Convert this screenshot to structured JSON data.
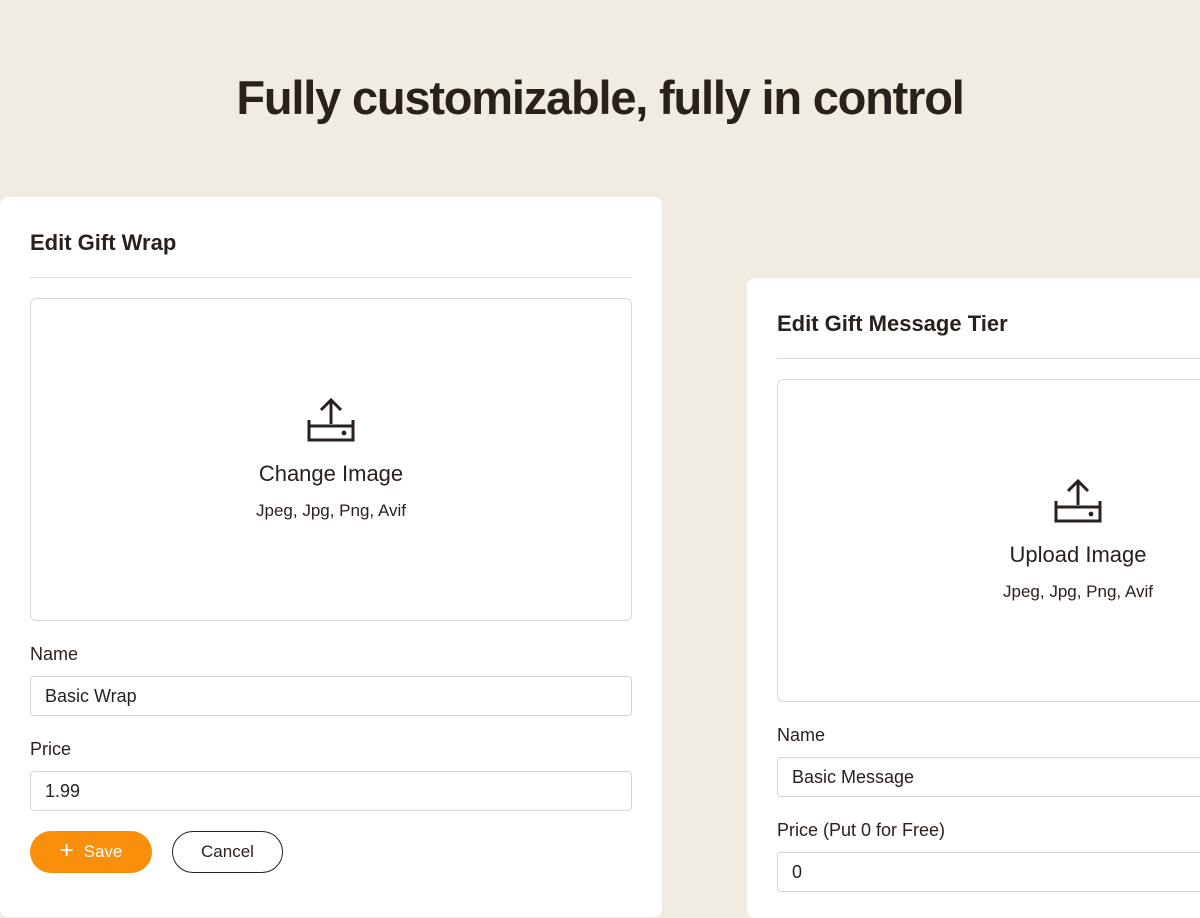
{
  "hero": {
    "title": "Fully customizable, fully in control"
  },
  "gift_wrap_card": {
    "title": "Edit Gift Wrap",
    "upload": {
      "icon": "upload-tray-icon",
      "title": "Change Image",
      "formats": "Jpeg, Jpg, Png, Avif"
    },
    "name": {
      "label": "Name",
      "value": "Basic Wrap"
    },
    "price": {
      "label": "Price",
      "value": "1.99"
    },
    "save_label": "Save",
    "cancel_label": "Cancel"
  },
  "gift_message_card": {
    "title": "Edit Gift Message Tier",
    "upload": {
      "icon": "upload-tray-icon",
      "title": "Upload Image",
      "formats": "Jpeg, Jpg, Png, Avif"
    },
    "name": {
      "label": "Name",
      "value": "Basic Message"
    },
    "price": {
      "label": "Price (Put 0 for Free)",
      "value": "0"
    }
  },
  "colors": {
    "background": "#f1ece1",
    "accent": "#f98f0a",
    "text": "#2a211d"
  }
}
